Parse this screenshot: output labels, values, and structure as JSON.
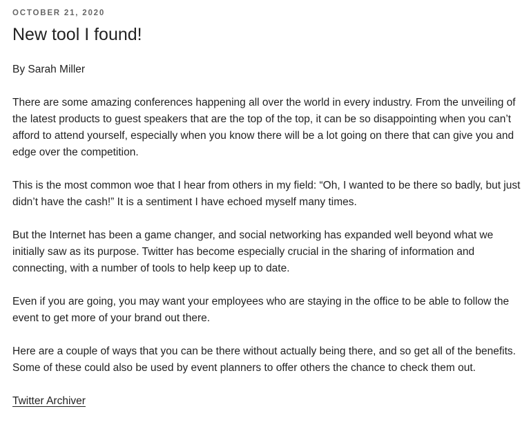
{
  "post": {
    "date": "October 21, 2020",
    "title": "New tool I found!",
    "byline": "By Sarah Miller",
    "paragraphs": [
      "There are some amazing conferences happening all over the world in every industry. From the unveiling of the latest products to guest speakers that are the top of the top, it can be so disappointing when you can’t afford to attend yourself, especially when you know there will be a lot going on there that can give you and edge over the competition.",
      "This is the most common woe that I hear from others in my field: “Oh, I wanted to be there so badly, but just didn’t have the cash!” It is a sentiment I have echoed myself many times.",
      "But the Internet has been a game changer, and social networking has expanded well beyond what we initially saw as its purpose. Twitter has become especially crucial in the sharing of information and connecting, with a number of tools to help keep up to date.",
      "Even if you are going, you may want your employees who are staying in the office to be able to follow the event to get more of your brand out there.",
      "Here are a couple of ways that you can be there without actually being there, and so get all of the benefits. Some of these could also be used by event planners to offer others the chance to check them out."
    ],
    "link_label": "Twitter Archiver"
  }
}
